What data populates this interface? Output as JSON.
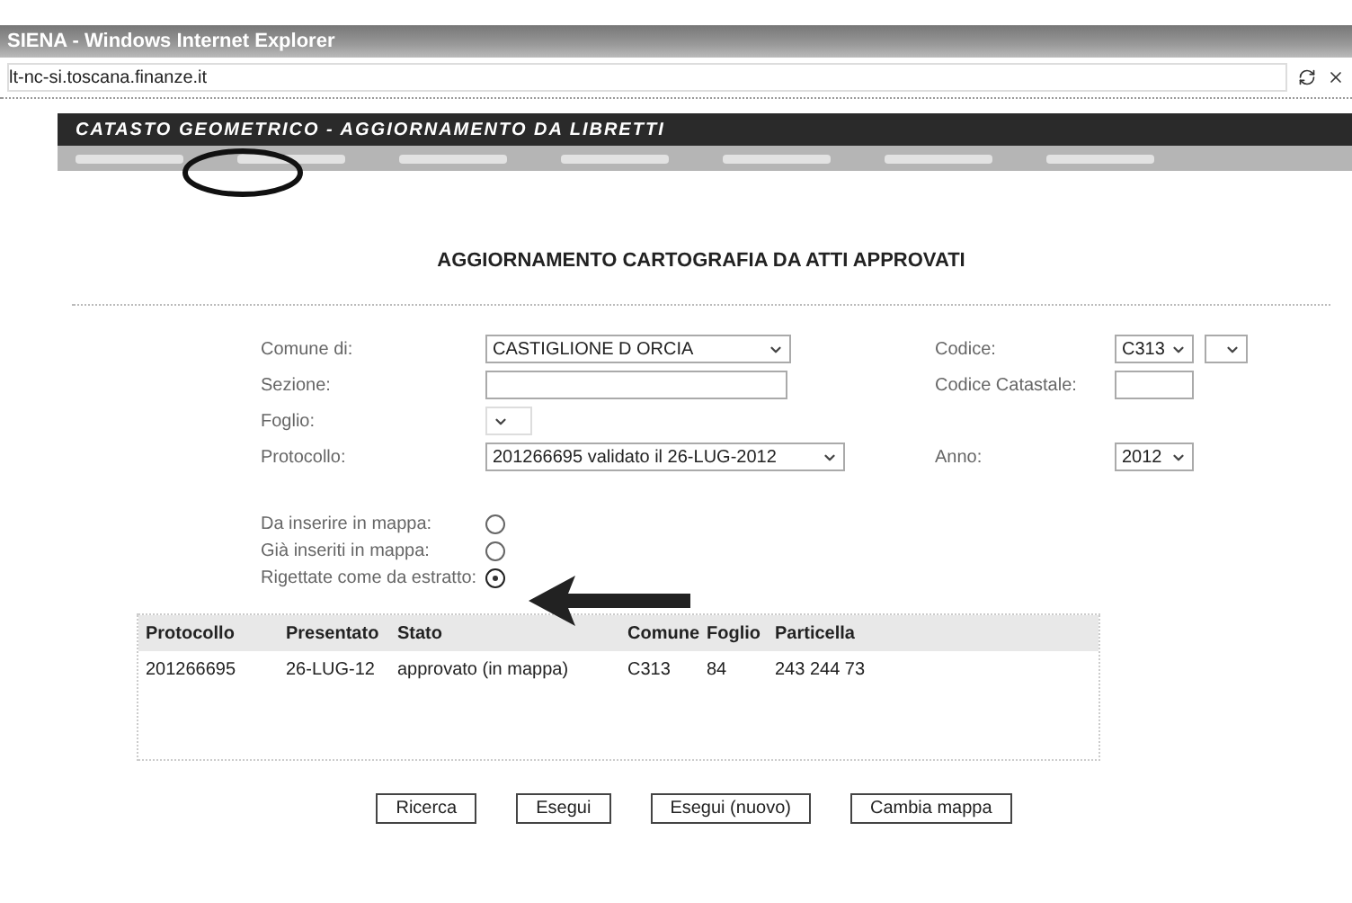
{
  "window": {
    "title": "SIENA - Windows Internet Explorer"
  },
  "address_bar": {
    "url": "lt-nc-si.toscana.finanze.it"
  },
  "app_header": {
    "title": "CATASTO GEOMETRICO - AGGIORNAMENTO DA LIBRETTI"
  },
  "page_title": "AGGIORNAMENTO CARTOGRAFIA DA ATTI APPROVATI",
  "form_left": [
    {
      "label": "Comune di:",
      "kind": "select",
      "value": "CASTIGLIONE D ORCIA",
      "disabled": false
    },
    {
      "label": "Sezione:",
      "kind": "text",
      "disabled": false
    },
    {
      "label": "Foglio:",
      "kind": "select",
      "disabled": true
    },
    {
      "label": "Protocollo:",
      "kind": "select",
      "value": "201266695 validato il 26-LUG-2012",
      "disabled": false
    }
  ],
  "form_right": [
    {
      "label": "Codice:",
      "kind": "double_select",
      "value": "C313"
    },
    {
      "label": "Codice Catastale:",
      "kind": "text"
    },
    {
      "kind": "none"
    },
    {
      "label": "Anno:",
      "kind": "select",
      "value": "2012"
    }
  ],
  "radios": [
    {
      "label": "Da inserire in mappa:",
      "selected": false
    },
    {
      "label": "Già inseriti in mappa:",
      "selected": false
    },
    {
      "label": "Rigettate come da estratto:",
      "selected": true
    }
  ],
  "table": {
    "columns": [
      "Protocollo",
      "Presentato",
      "Stato",
      "Comune",
      "Foglio",
      "Particella"
    ],
    "rows": [
      [
        "201266695",
        "26-LUG-12",
        "approvato (in mappa)",
        "C313",
        "84",
        "243 244 73"
      ]
    ]
  },
  "buttons": [
    "Ricerca",
    "Esegui",
    "Esegui (nuovo)",
    "Cambia mappa"
  ]
}
